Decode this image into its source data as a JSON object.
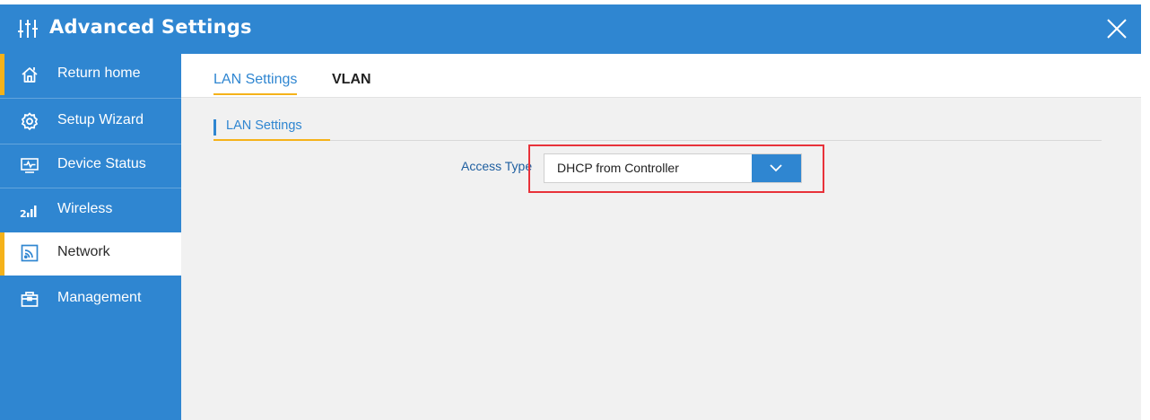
{
  "window": {
    "title": "Advanced Settings",
    "title_icon": "sliders-icon",
    "close_icon": "close-icon"
  },
  "sidebar": {
    "items": [
      {
        "label": "Return home",
        "icon": "home-icon"
      },
      {
        "label": "Setup Wizard",
        "icon": "gear-icon"
      },
      {
        "label": "Device Status",
        "icon": "monitor-icon"
      },
      {
        "label": "Wireless",
        "icon": "signal-icon"
      },
      {
        "label": "Network",
        "icon": "network-icon",
        "active": true
      },
      {
        "label": "Management",
        "icon": "toolbox-icon"
      }
    ]
  },
  "tabs": [
    {
      "label": "LAN Settings",
      "active": true
    },
    {
      "label": "VLAN",
      "active": false
    }
  ],
  "section": {
    "title": "LAN Settings"
  },
  "access_type": {
    "label": "Access Type",
    "value": "DHCP from Controller",
    "dropdown_icon": "chevron-down-icon"
  },
  "colors": {
    "primary": "#2f86d1",
    "accent": "#f5b21a",
    "highlight": "#e8323a",
    "content_bg": "#f1f1f1"
  }
}
